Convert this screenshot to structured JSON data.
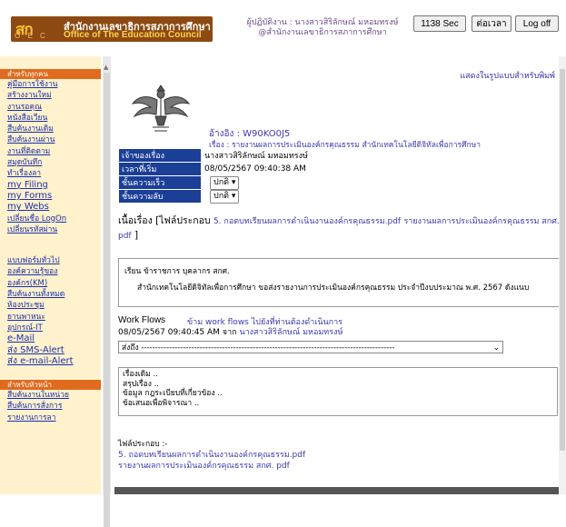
{
  "header": {
    "logo_abbr": "สก",
    "logo_letters": "O E C",
    "org_name_th": "สำนักงานเลขาธิการสภาการศึกษา",
    "org_name_en": "Office of The Education Council",
    "user_line1": "ผู้ปฏิบัติงาน : นางสาวสิริลักษณ์ มหอมทรงษ์",
    "user_line2": "@สำนักงานเลขาธิการสภาการศึกษา",
    "session_label": "1138 Sec",
    "extend_label": "ต่อเวลา",
    "logoff_label": "Log off"
  },
  "sidebar": {
    "section1_title": "สำหรับทุกคน",
    "section1_items": [
      "คู่มือการใช้งาน",
      "สร้างงานใหม่",
      "งานรอคุณ",
      "หนังสือเวียน",
      "สืบค้นงานเดิม",
      "สืบค้นงานผ่าน",
      "งานที่ติดตาม",
      "สมุดบันทึก",
      "ทำเรื่องลา",
      "my Filing",
      "my Forms",
      "my Webs",
      "เปลี่ยนชื่อ LogOn",
      "เปลี่ยนรหัสผ่าน"
    ],
    "section2_items": [
      "แบบฟอร์มทั่วไป",
      "องค์ความรู้ของ",
      "องค์กร(KM)",
      "สืบค้นงานทั้งหมด",
      "ห้องประชุม",
      "ยานพาหนะ",
      "อุปกรณ์-IT",
      "e-Mail",
      "ส่ง SMS-Alert",
      "ส่ง e-mail-Alert"
    ],
    "section3_title": "สำหรับหัวหน้า",
    "section3_items": [
      "สืบค้นงานในหน่วย",
      "สืบค้นการสั่งการ",
      "รายงานการลา"
    ]
  },
  "main": {
    "print_link": "แสดงในรูปแบบสำหรับพิมพ์",
    "ref_no": "อ้างอิง : W90KO0J5",
    "subject": "เรื่อง : รายงานผลการประเมินองค์กรคุณธรรม สำนักเทคโนโลยีดิจิทัลเพื่อการศึกษา",
    "fields": [
      {
        "label": "เจ้าของเรื่อง",
        "value": "นางสาวสิริลักษณ์ มหอมทรงษ์"
      },
      {
        "label": "เวลาที่เริ่ม",
        "value": "08/05/2567 09:40:38 AM"
      },
      {
        "label": "ชั้นความเร็ว",
        "value": "ปกติ"
      },
      {
        "label": "ชั้นความลับ",
        "value": "ปกติ"
      }
    ],
    "attach_label": "เนื้อเรื่อง [ไฟล์ประกอบ",
    "attach_file1": "5. กอตบทเรียนผลการดำเนินงานองค์กรคุณธรรม.pdf",
    "attach_file2": "รายงานผลการประเมินองค์กรคุณธรรม สกศ. pdf",
    "attach_close": "]",
    "body_line1": "เรียน  ข้าราชการ บุคลากร สกศ.",
    "body_line2": "สำนักเทคโนโลยีดิจิทัลเพื่อการศึกษา ขอส่งรายงานการประเมินองค์กรคุณธรรม ประจำปีงบประมาณ พ.ศ. 2567 ดังแนบ",
    "workflow_title": "Work Flows",
    "workflow_link": "ข้าม work flows ไปยังที่ท่านต้องดำเนินการ",
    "workflow_time": "08/05/2567 09:40:45 AM จาก",
    "workflow_from": "นางสาวสิริลักษณ์ มหอมทรงษ์",
    "sendto_label": "ส่งถึง -------------------------------------------------------------------------------------------",
    "notes": [
      "เรื่องเดิม ..",
      "สรุปเรื่อง ..",
      "ข้อมูล กฎระเบียบที่เกี่ยวข้อง ..",
      "ข้อเสนอเพื่อพิจารณา .."
    ],
    "attach_list_label": "ไฟล์ประกอบ :-",
    "attach_list": [
      "5. ถอดบทเรียนผลการดำเนินงานองค์กรคุณธรรม.pdf",
      "รายงานผลการประเมินองค์กรคุณธรรม สกศ. pdf"
    ]
  },
  "icons": {
    "dropdown": "chevron-down-icon",
    "emblem": "garuda-emblem-icon"
  },
  "colors": {
    "brand": "#8c4a12",
    "label_bg": "#1b3f97",
    "sidebar_bg": "#fff2cc",
    "sidebar_head": "#e06b1f",
    "link": "#1a2fb0"
  }
}
